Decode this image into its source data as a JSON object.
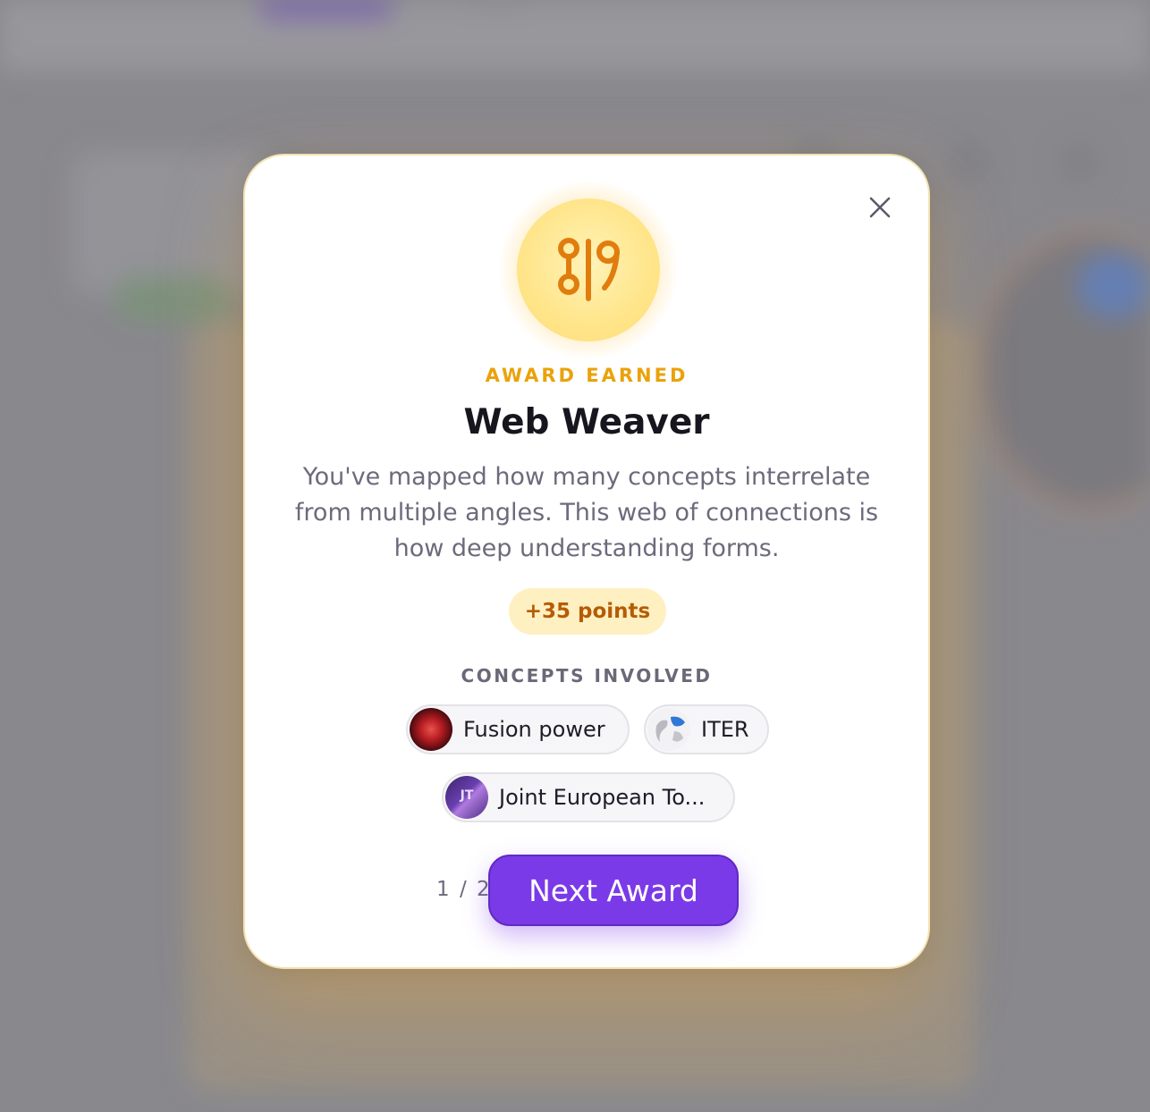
{
  "modal": {
    "eyebrow": "AWARD EARNED",
    "title": "Web Weaver",
    "description": "You've mapped how many concepts interrelate from multiple angles. This web of connections is how deep understanding forms.",
    "points": "+35 points",
    "concepts_label": "CONCEPTS INVOLVED",
    "concepts": [
      {
        "label": "Fusion power",
        "icon": "fusion-plasma-thumbnail"
      },
      {
        "label": "ITER",
        "icon": "globe-thumbnail"
      },
      {
        "label": "Joint European To...",
        "icon": "jet-thumbnail",
        "thumb_text": "JT"
      }
    ],
    "pager": "1 / 2",
    "next_label": "Next Award",
    "close_icon": "close-icon",
    "badge_icon": "web-weaver-icon"
  },
  "colors": {
    "accent": "#7b3ae8",
    "award": "#eaa20a",
    "points_text": "#b45c05",
    "points_bg": "#fff0c2",
    "badge_icon": "#e07d0e"
  }
}
